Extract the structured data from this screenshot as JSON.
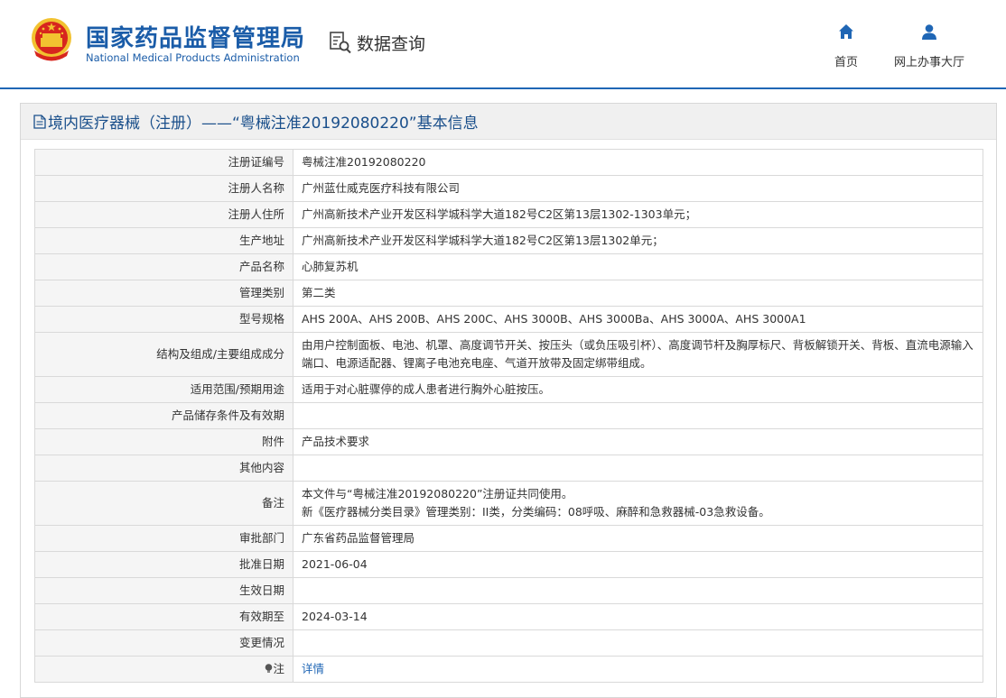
{
  "header": {
    "agency_cn": "国家药品监督管理局",
    "agency_en": "National Medical Products Administration",
    "search_label": "数据查询",
    "nav": [
      {
        "label": "首页",
        "icon": "home-icon"
      },
      {
        "label": "网上办事大厅",
        "icon": "user-icon"
      }
    ]
  },
  "panel": {
    "title": "境内医疗器械（注册）——“粤械注准20192080220”基本信息"
  },
  "rows": [
    {
      "key": "注册证编号",
      "value": "粤械注准20192080220"
    },
    {
      "key": "注册人名称",
      "value": "广州蓝仕威克医疗科技有限公司"
    },
    {
      "key": "注册人住所",
      "value": "广州高新技术产业开发区科学城科学大道182号C2区第13层1302-1303单元；"
    },
    {
      "key": "生产地址",
      "value": "广州高新技术产业开发区科学城科学大道182号C2区第13层1302单元；"
    },
    {
      "key": "产品名称",
      "value": "心肺复苏机"
    },
    {
      "key": "管理类别",
      "value": "第二类"
    },
    {
      "key": "型号规格",
      "value": "AHS 200A、AHS 200B、AHS 200C、AHS 3000B、AHS 3000Ba、AHS 3000A、AHS 3000A1"
    },
    {
      "key": "结构及组成/主要组成成分",
      "value": "由用户控制面板、电池、机罩、高度调节开关、按压头（或负压吸引杯）、高度调节杆及胸厚标尺、背板解锁开关、背板、直流电源输入端口、电源适配器、锂离子电池充电座、气道开放带及固定绑带组成。"
    },
    {
      "key": "适用范围/预期用途",
      "value": "适用于对心脏骤停的成人患者进行胸外心脏按压。"
    },
    {
      "key": "产品储存条件及有效期",
      "value": ""
    },
    {
      "key": "附件",
      "value": "产品技术要求"
    },
    {
      "key": "其他内容",
      "value": ""
    },
    {
      "key": "备注",
      "value_line1": "本文件与“粤械注准20192080220”注册证共同使用。",
      "value_line2": "新《医疗器械分类目录》管理类别：II类，分类编码：08呼吸、麻醉和急救器械-03急救设备。"
    },
    {
      "key": "审批部门",
      "value": "广东省药品监督管理局"
    },
    {
      "key": "批准日期",
      "value": "2021-06-04"
    },
    {
      "key": "生效日期",
      "value": ""
    },
    {
      "key": "有效期至",
      "value": "2024-03-14"
    },
    {
      "key": "变更情况",
      "value": ""
    },
    {
      "key": "注",
      "value": "详情",
      "icon": "bulb-icon"
    }
  ],
  "colors": {
    "brand_blue": "#1a5ca8",
    "header_line": "#1f66b5",
    "link": "#1f66b5",
    "title_bg": "#f0f0f0",
    "key_bg": "#f5f5f5",
    "emblem_red": "#d7261e",
    "emblem_gold": "#f2c230"
  }
}
